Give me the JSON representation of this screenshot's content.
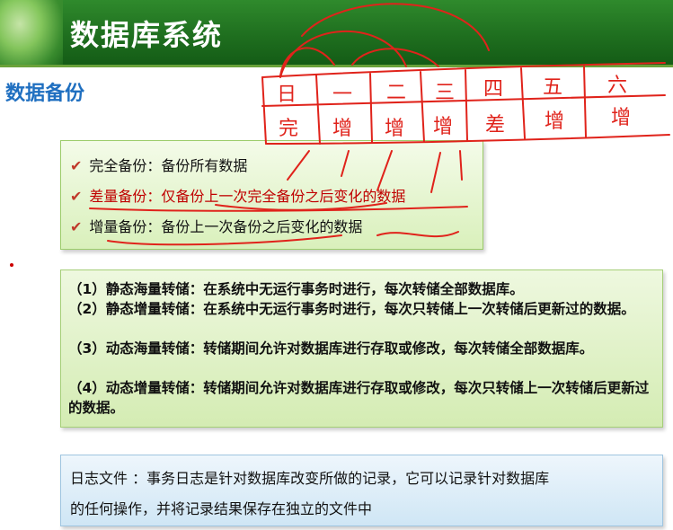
{
  "header": {
    "title": "数据库系统"
  },
  "section": {
    "title": "数据备份"
  },
  "backup_types": [
    {
      "label": "完全备份：备份所有数据"
    },
    {
      "label": "差量备份：仅备份上一次完全备份之后变化的数据"
    },
    {
      "label": "增量备份：备份上一次备份之后变化的数据"
    }
  ],
  "dump_types": [
    "（1）静态海量转储：在系统中无运行事务时进行，每次转储全部数据库。",
    "（2）静态增量转储：在系统中无运行事务时进行，每次只转储上一次转储后更新过的数据。",
    "（3）动态海量转储：转储期间允许对数据库进行存取或修改，每次转储全部数据库。",
    "（4）动态增量转储：转储期间允许对数据库进行存取或修改，每次只转储上一次转储后更新过的数据。"
  ],
  "log": {
    "line1": "日志文件 ：事务日志是针对数据库改变所做的记录，它可以记录针对数据库",
    "line2": "的任何操作，并将记录结果保存在独立的文件中"
  },
  "annotation": {
    "days": [
      "日",
      "一",
      "二",
      "三",
      "四",
      "五",
      "六"
    ],
    "types": [
      "完",
      "增",
      "增",
      "增",
      "差",
      "增",
      "增"
    ],
    "color": "#e0231b"
  }
}
